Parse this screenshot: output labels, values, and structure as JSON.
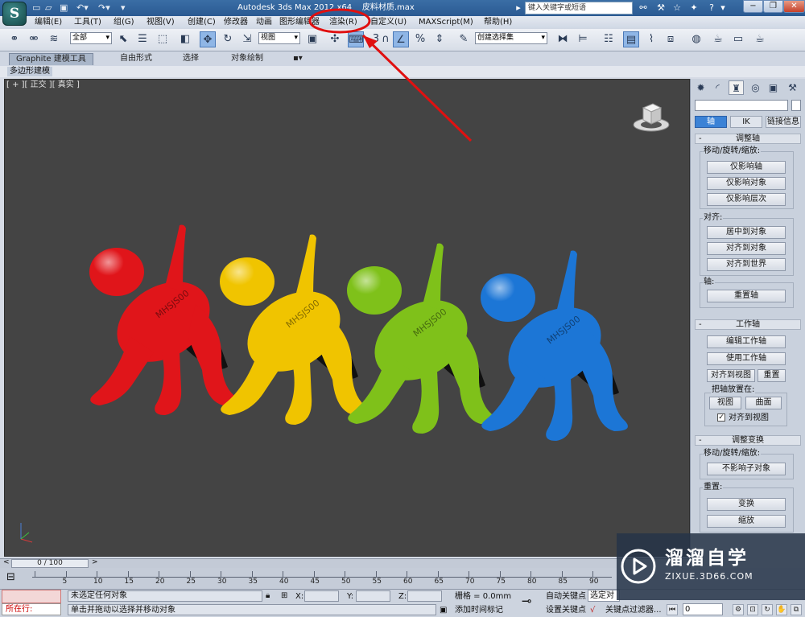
{
  "app": {
    "logo_letter": "S",
    "title": "Autodesk 3ds Max  2012 x64",
    "file_name": "皮料材质.max",
    "search_placeholder": "键入关键字或短语"
  },
  "menu": [
    "编辑(E)",
    "工具(T)",
    "组(G)",
    "视图(V)",
    "创建(C)",
    "修改器",
    "动画",
    "图形编辑器",
    "渲染(R)",
    "自定义(U)",
    "MAXScript(M)",
    "帮助(H)"
  ],
  "toolbar": {
    "selection_filter": "全部",
    "reference_coord": "视图",
    "snap_label": "3",
    "named_selection": "创建选择集"
  },
  "ribbon": {
    "tabs": [
      "Graphite 建模工具",
      "自由形式",
      "选择",
      "对象绘制"
    ],
    "subtab": "多边形建模"
  },
  "viewport": {
    "label": "[ + ][ 正交 ][ 真实 ]",
    "model_text": "MHSJS00",
    "object_colors": [
      "#e0151a",
      "#f0c400",
      "#7fc11a",
      "#1c76d6"
    ]
  },
  "command_panel": {
    "tabs": [
      "create-icon",
      "modify-icon",
      "hierarchy-icon",
      "motion-icon",
      "display-icon",
      "utilities-icon"
    ],
    "sub_tabs": [
      "轴",
      "IK",
      "链接信息"
    ],
    "adjust_pivot": {
      "title": "调整轴",
      "move_group": "移动/旋转/缩放:",
      "move_buttons": [
        "仅影响轴",
        "仅影响对象",
        "仅影响层次"
      ],
      "align_group": "对齐:",
      "align_buttons": [
        "居中到对象",
        "对齐到对象",
        "对齐到世界"
      ],
      "pivot_group": "轴:",
      "pivot_button": "重置轴"
    },
    "working_pivot": {
      "title": "工作轴",
      "edit": "编辑工作轴",
      "use": "使用工作轴",
      "align_view": "对齐到视图",
      "reset": "重置",
      "place_group": "把轴放置在:",
      "view": "视图",
      "surface": "曲面",
      "align_checkbox": "对齐到视图"
    },
    "adjust_transform": {
      "title": "调整变换",
      "move_group": "移动/旋转/缩放:",
      "no_affect_children": "不影响子对象",
      "reset_group": "重置:",
      "transform": "变换",
      "scale": "缩放"
    }
  },
  "timeline": {
    "frame_display": "0 / 100",
    "ticks": [
      "0",
      "5",
      "10",
      "15",
      "20",
      "25",
      "30",
      "35",
      "40",
      "45",
      "50",
      "55",
      "60",
      "65",
      "70",
      "75",
      "80",
      "85",
      "90"
    ]
  },
  "status": {
    "listener_run": "所在行:",
    "selection": "未选定任何对象",
    "prompt": "单击并拖动以选择并移动对象",
    "x_label": "X:",
    "y_label": "Y:",
    "z_label": "Z:",
    "grid": "栅格 = 0.0mm",
    "add_time_tag": "添加时间标记",
    "auto_key": "自动关键点",
    "selected_dropdown": "选定对",
    "set_key": "设置关键点",
    "key_filters": "关键点过滤器...",
    "frame_value": "0"
  },
  "watermark": {
    "title": "溜溜自学",
    "url": "ZIXUE.3D66.COM"
  }
}
